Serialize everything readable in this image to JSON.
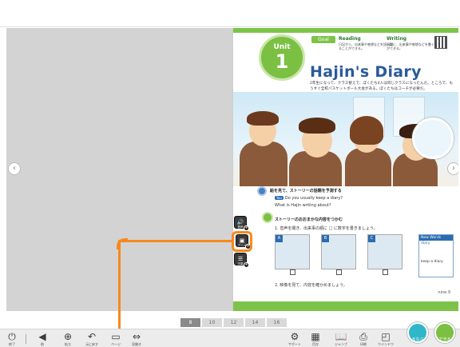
{
  "unit": {
    "label": "Unit",
    "number": "1"
  },
  "goal": {
    "tag": "Goal",
    "reading_title": "Reading",
    "reading_text": "日記から、出来事や感想などを読み取ることができる。",
    "writing_title": "Writing",
    "writing_text": "日記に、出来事や感想などを書くことができる。"
  },
  "lesson": {
    "title": "Hajin's Diary",
    "subtitle": "2年生になって、クラス替えで、ぼくたち4人は同じクラスになったんだ。ところで、もうすぐ全校バスケットボール大会がある。ぼくたちはコーチが必要だ。"
  },
  "questions": {
    "heading": "絵を見て、ストーリーの話題を予測する",
    "you_tag": "You",
    "q1": "Do you usually keep a diary?",
    "q2": "What is Hajin writing about?",
    "heading2": "ストーリーのおおまかな内容をつかむ",
    "task1": "1. 音声を聞き、出来事の順に □ に数字を書きましょう。",
    "task2": "2. 映像を見て、内容を確かめましょう。",
    "frames": [
      "A",
      "B",
      "C"
    ]
  },
  "new_words": {
    "head": "New Words",
    "word": "diary",
    "phrase": "keep a diary"
  },
  "page_number": "9",
  "page_label": "nine",
  "side_tools": [
    {
      "icon": "speaker-icon",
      "glyph": "🔊",
      "label": "音声"
    },
    {
      "icon": "video-icon",
      "glyph": "▣",
      "label": "アニメ"
    },
    {
      "icon": "subtitle-icon",
      "glyph": "☰",
      "label": "字幕"
    }
  ],
  "page_strip": [
    "8",
    "10",
    "12",
    "14",
    "16"
  ],
  "toolbar": {
    "items": [
      {
        "icon": "power-icon",
        "glyph": "⏻",
        "label": "終了"
      },
      {
        "icon": "previous-icon",
        "glyph": "◀",
        "label": "前"
      },
      {
        "icon": "zoom-icon",
        "glyph": "⊕",
        "label": "拡大"
      },
      {
        "icon": "undo-icon",
        "glyph": "↶",
        "label": "元に戻す"
      },
      {
        "icon": "page-icon",
        "glyph": "▭",
        "label": "ページ"
      },
      {
        "icon": "spread-icon",
        "glyph": "⇔",
        "label": "見開き"
      },
      {
        "icon": "settings-icon",
        "glyph": "⚙",
        "label": "サポート"
      },
      {
        "icon": "grid-icon",
        "glyph": "▦",
        "label": "目次"
      },
      {
        "icon": "book-icon",
        "glyph": "📖",
        "label": "ジャンプ"
      },
      {
        "icon": "print-icon",
        "glyph": "⎙",
        "label": "印刷"
      },
      {
        "icon": "window-icon",
        "glyph": "◰",
        "label": "ウインドウ"
      }
    ],
    "round_buttons": [
      {
        "icon": "learn-icon",
        "label": "まなぶ",
        "color": "#2fb6c9"
      },
      {
        "icon": "done-icon",
        "label": "できる",
        "color": "#7bc043"
      }
    ]
  },
  "colors": {
    "accent": "#f7891e",
    "brand_green": "#7dc34a",
    "brand_blue": "#2b6cb0"
  }
}
